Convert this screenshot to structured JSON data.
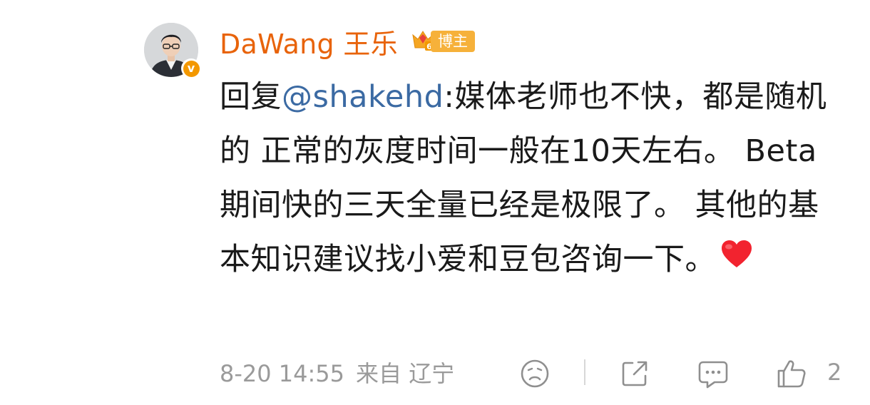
{
  "user": {
    "name": "DaWang 王乐",
    "badge_label": "博主",
    "badge_level": "6"
  },
  "post": {
    "prefix": "回复",
    "mention": "@shakehd",
    "text": ":媒体老师也不快，都是随机的 正常的灰度时间一般在10天左右。 Beta期间快的三天全量已经是极限了。 其他的基本知识建议找小爱和豆包咨询一下。"
  },
  "footer": {
    "datetime": "8-20 14:55",
    "location": "来自 辽宁",
    "like_count": "2"
  },
  "colors": {
    "username": "#e8630a",
    "mention": "#3b6aa3",
    "meta": "#9a9a9a",
    "verified": "#f39800"
  },
  "icons": [
    "verified-v-icon",
    "crown-level-icon",
    "heart-emoji-icon",
    "emoji-reaction-icon",
    "share-icon",
    "comment-icon",
    "thumbs-up-icon"
  ]
}
